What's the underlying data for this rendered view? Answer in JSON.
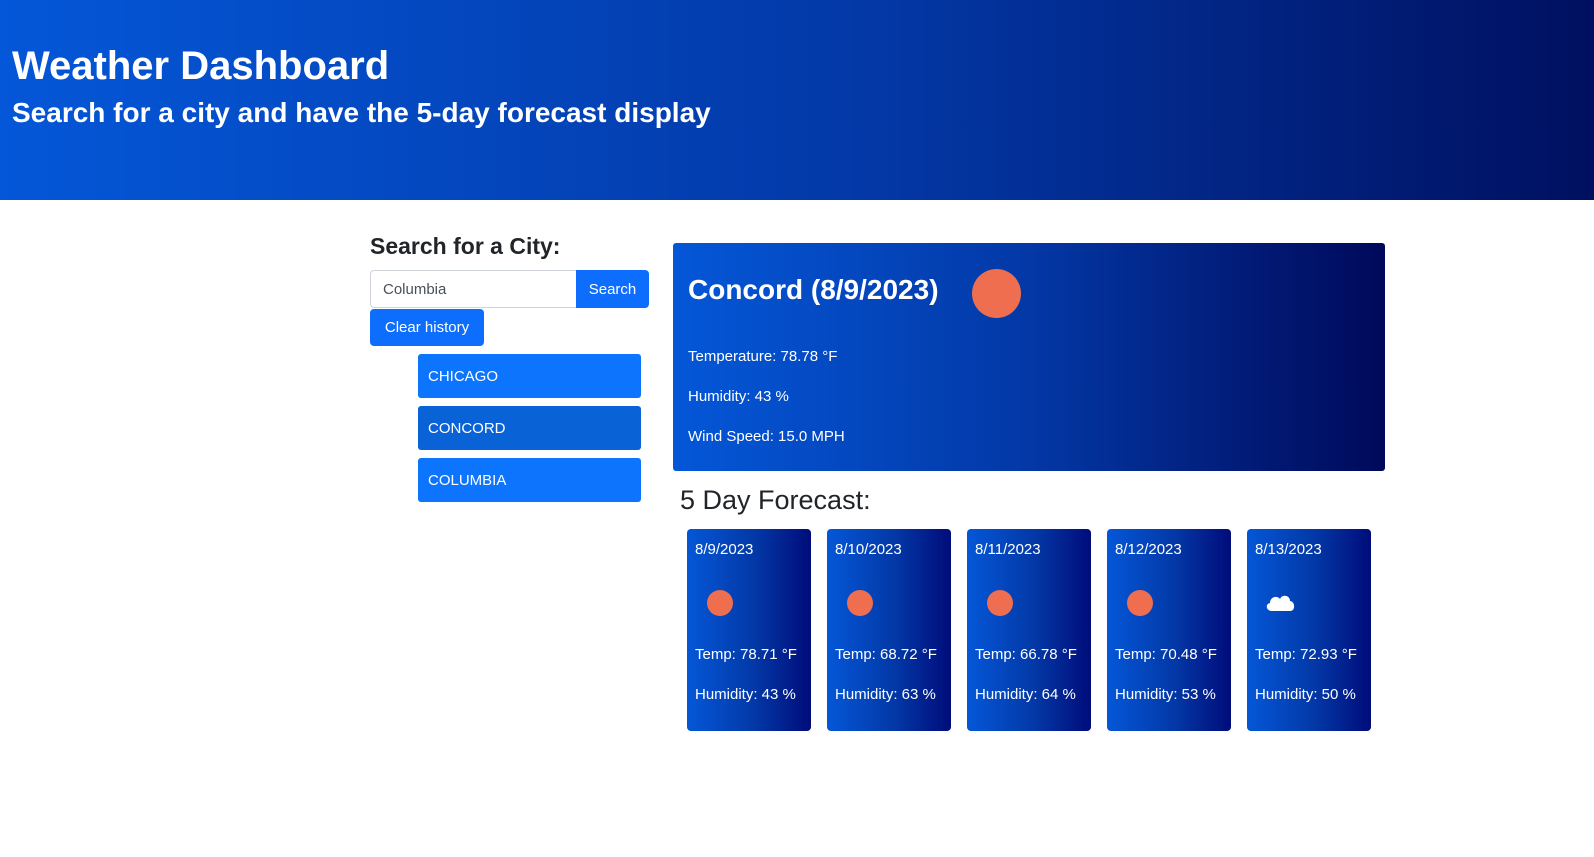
{
  "header": {
    "title": "Weather Dashboard",
    "subtitle": "Search for a city and have the 5-day forecast display"
  },
  "search": {
    "title": "Search for a City:",
    "input_value": "Columbia",
    "button_label": "Search",
    "clear_label": "Clear history"
  },
  "history": [
    {
      "label": "CHICAGO"
    },
    {
      "label": "CONCORD"
    },
    {
      "label": "COLUMBIA"
    }
  ],
  "current": {
    "title": "Concord (8/9/2023)",
    "icon": "sun-icon",
    "temperature": "Temperature: 78.78 °F",
    "humidity": "Humidity: 43 %",
    "wind": "Wind Speed: 15.0 MPH"
  },
  "forecast": {
    "title": "5 Day Forecast:",
    "days": [
      {
        "date": "8/9/2023",
        "icon": "sun-icon",
        "temp": "Temp: 78.71 °F",
        "humidity": "Humidity: 43 %"
      },
      {
        "date": "8/10/2023",
        "icon": "sun-icon",
        "temp": "Temp: 68.72 °F",
        "humidity": "Humidity: 63 %"
      },
      {
        "date": "8/11/2023",
        "icon": "sun-icon",
        "temp": "Temp: 66.78 °F",
        "humidity": "Humidity: 64 %"
      },
      {
        "date": "8/12/2023",
        "icon": "sun-icon",
        "temp": "Temp: 70.48 °F",
        "humidity": "Humidity: 53 %"
      },
      {
        "date": "8/13/2023",
        "icon": "cloud-icon",
        "temp": "Temp: 72.93 °F",
        "humidity": "Humidity: 50 %"
      }
    ]
  },
  "colors": {
    "accent": "#0d6efd",
    "sun": "#ef6e4f"
  }
}
